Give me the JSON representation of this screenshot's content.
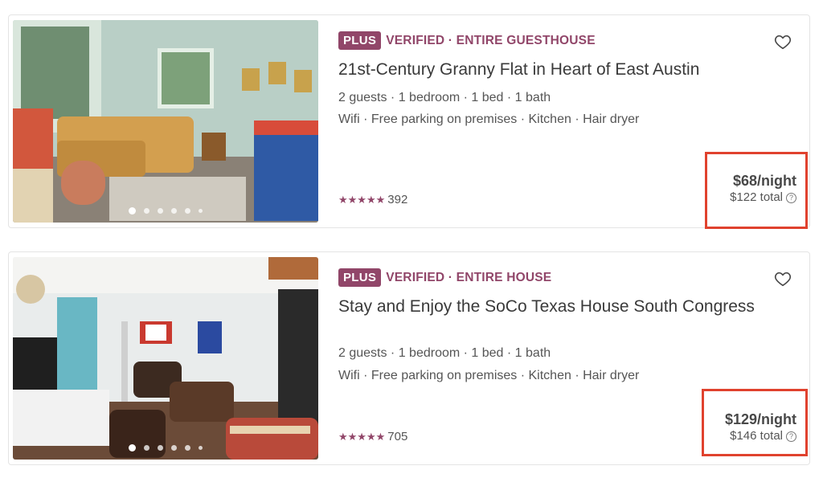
{
  "colors": {
    "accent": "#914669",
    "highlight_border": "#e0422e",
    "text_primary": "#3a3a3a",
    "text_secondary": "#555555"
  },
  "listings": [
    {
      "badge": "PLUS",
      "verified_label": "VERIFIED · ENTIRE GUESTHOUSE",
      "title": "21st-Century Granny Flat in Heart of East Austin",
      "rooms": "2 guests · 1 bedroom · 1 bed · 1 bath",
      "amenities": "Wifi · Free parking on premises · Kitchen · Hair dryer",
      "stars": "★★★★★",
      "rating": 5,
      "review_count": "392",
      "price_per_night": "$68/night",
      "price_total": "$122 total",
      "help_icon": "?",
      "photo_count": 6,
      "active_photo": 1,
      "icons": [
        "heart-icon",
        "help-circle-icon"
      ]
    },
    {
      "badge": "PLUS",
      "verified_label": "VERIFIED · ENTIRE HOUSE",
      "title": "Stay and Enjoy the SoCo Texas House South Congress",
      "rooms": "2 guests · 1 bedroom · 1 bed · 1 bath",
      "amenities": "Wifi · Free parking on premises · Kitchen · Hair dryer",
      "stars": "★★★★★",
      "rating": 5,
      "review_count": "705",
      "price_per_night": "$129/night",
      "price_total": "$146 total",
      "help_icon": "?",
      "photo_count": 6,
      "active_photo": 1,
      "icons": [
        "heart-icon",
        "help-circle-icon"
      ]
    }
  ]
}
